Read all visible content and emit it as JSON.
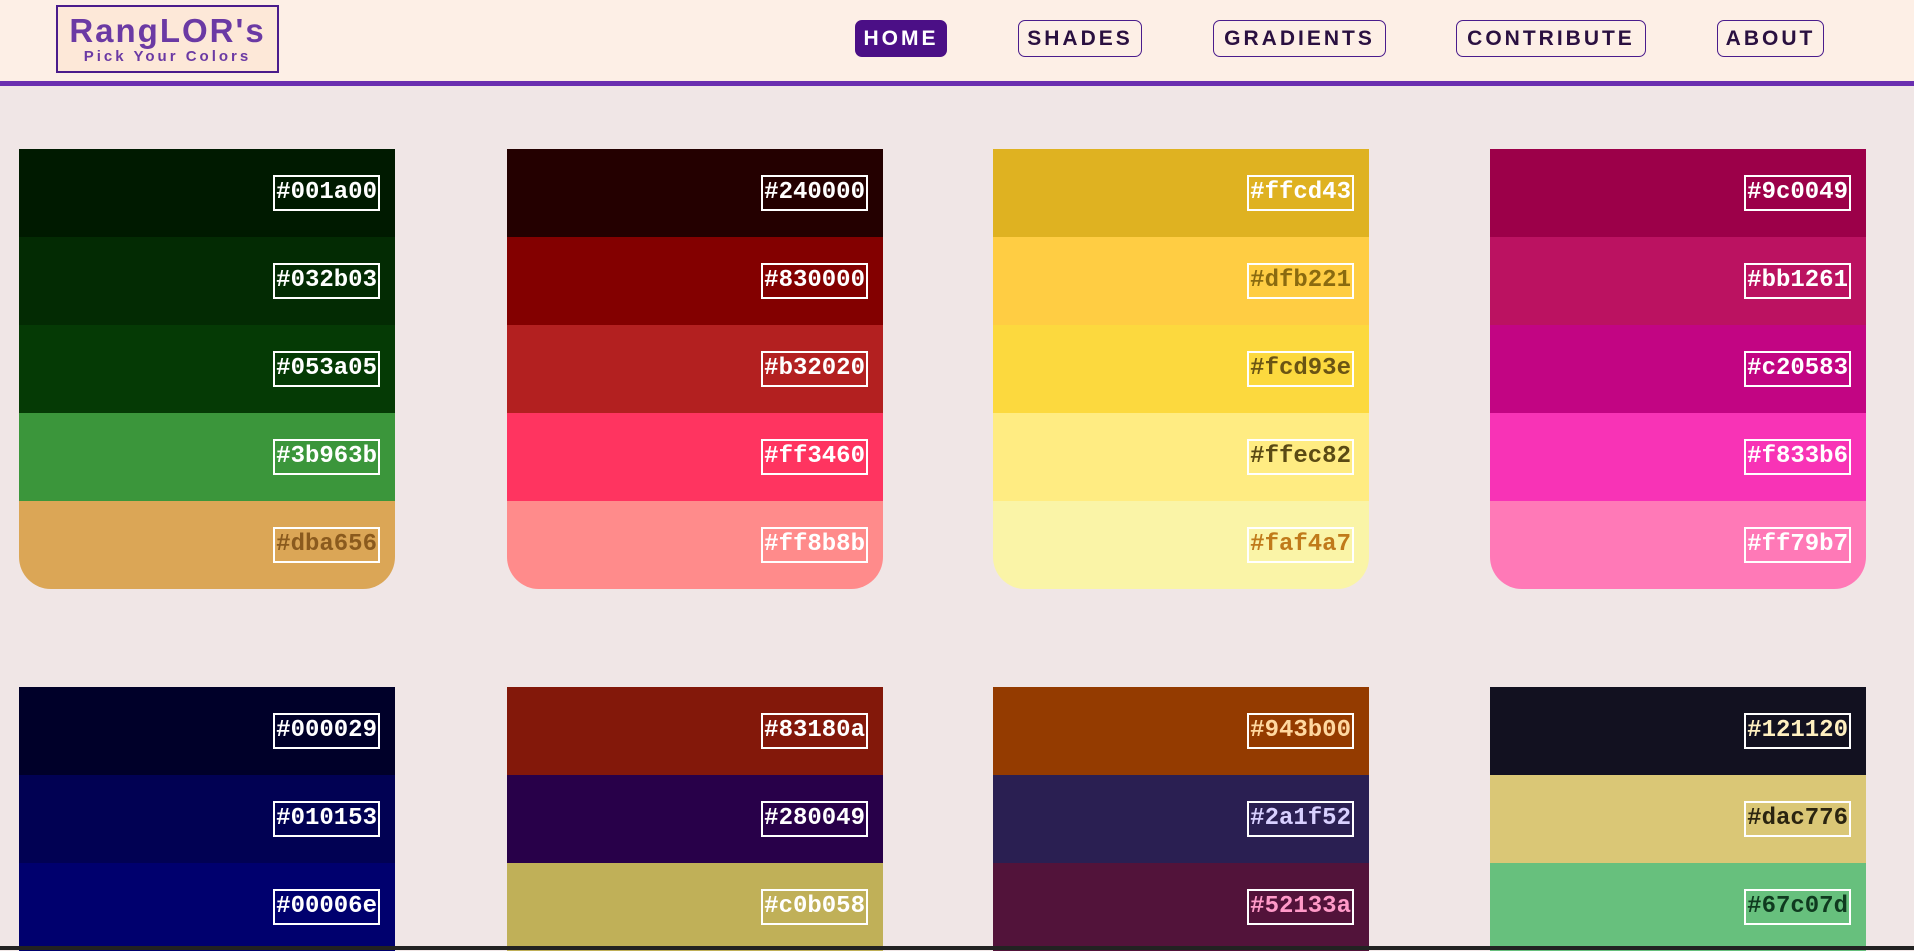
{
  "logo": {
    "title": "RangLOR's",
    "subtitle": "Pick Your Colors"
  },
  "nav": [
    {
      "label": "HOME",
      "active": true
    },
    {
      "label": "SHADES",
      "active": false
    },
    {
      "label": "GRADIENTS",
      "active": false
    },
    {
      "label": "CONTRIBUTE",
      "active": false
    },
    {
      "label": "ABOUT",
      "active": false
    }
  ],
  "palettes": [
    {
      "colors": [
        {
          "hex": "#001a00",
          "text": "#ffffff"
        },
        {
          "hex": "#032b03",
          "text": "#ffffff"
        },
        {
          "hex": "#053a05",
          "text": "#ffffff"
        },
        {
          "hex": "#3b963b",
          "text": "#ffffff"
        },
        {
          "hex": "#dba656",
          "text": "#8a5a1e"
        }
      ]
    },
    {
      "colors": [
        {
          "hex": "#240000",
          "text": "#ffffff"
        },
        {
          "hex": "#830000",
          "text": "#ffffff"
        },
        {
          "hex": "#b32020",
          "text": "#ffffff"
        },
        {
          "hex": "#ff3460",
          "text": "#ffffff"
        },
        {
          "hex": "#ff8b8b",
          "text": "#ffffff"
        }
      ]
    },
    {
      "colors": [
        {
          "hex": "#ffcd43",
          "text": "#ffffff",
          "bg": "#dfb221"
        },
        {
          "hex": "#dfb221",
          "text": "#8a6a10",
          "bg": "#ffcd43"
        },
        {
          "hex": "#fcd93e",
          "text": "#6a5414"
        },
        {
          "hex": "#ffec82",
          "text": "#5a4a14"
        },
        {
          "hex": "#faf4a7",
          "text": "#c07a1a"
        }
      ]
    },
    {
      "colors": [
        {
          "hex": "#9c0049",
          "text": "#ffffff"
        },
        {
          "hex": "#bb1261",
          "text": "#ffffff"
        },
        {
          "hex": "#c20583",
          "text": "#ffffff"
        },
        {
          "hex": "#f833b6",
          "text": "#ffffff"
        },
        {
          "hex": "#ff79b7",
          "text": "#ffffff"
        }
      ]
    },
    {
      "colors": [
        {
          "hex": "#000029",
          "text": "#ffffff"
        },
        {
          "hex": "#010153",
          "text": "#ffffff"
        },
        {
          "hex": "#00006e",
          "text": "#ffffff"
        }
      ]
    },
    {
      "colors": [
        {
          "hex": "#83180a",
          "text": "#ffffff"
        },
        {
          "hex": "#280049",
          "text": "#ffffff"
        },
        {
          "hex": "#c0b058",
          "text": "#ffffff"
        }
      ]
    },
    {
      "colors": [
        {
          "hex": "#943b00",
          "text": "#ffd8a0"
        },
        {
          "hex": "#2a1f52",
          "text": "#d8d0ff"
        },
        {
          "hex": "#52133a",
          "text": "#ff9ac8"
        }
      ]
    },
    {
      "colors": [
        {
          "hex": "#121120",
          "text": "#fff0c0"
        },
        {
          "hex": "#dac776",
          "text": "#2a2410"
        },
        {
          "hex": "#67c07d",
          "text": "#0f3a1f"
        }
      ]
    }
  ]
}
